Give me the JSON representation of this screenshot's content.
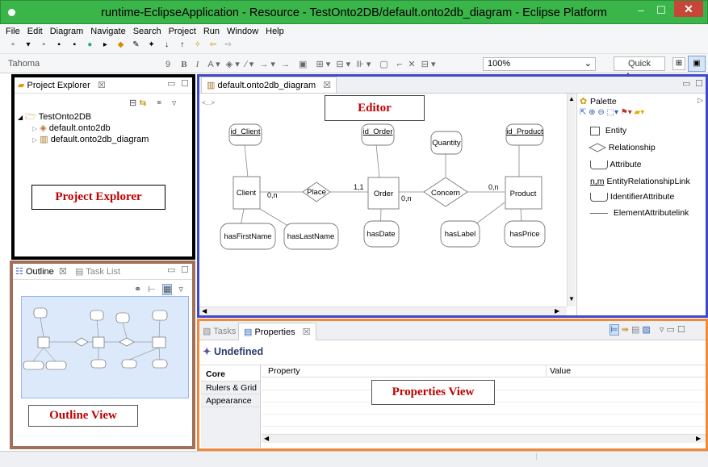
{
  "window": {
    "title": "runtime-EclipseApplication - Resource - TestOnto2DB/default.onto2db_diagram - Eclipse Platform",
    "minimize": "–",
    "maximize": "☐",
    "close": "✕"
  },
  "menu": [
    "File",
    "Edit",
    "Diagram",
    "Navigate",
    "Search",
    "Project",
    "Run",
    "Window",
    "Help"
  ],
  "toolbar2": {
    "font": "Tahoma",
    "font_size": "9",
    "bold": "B",
    "italic": "I",
    "zoom": "100%",
    "quick_access": "Quick Access"
  },
  "project_explorer": {
    "tab_label": "Project Explorer",
    "tab_close": "☒",
    "tree": {
      "project": "TestOnto2DB",
      "files": [
        "default.onto2db",
        "default.onto2db_diagram"
      ]
    },
    "annotation": "Project Explorer"
  },
  "outline": {
    "tab_label": "Outline",
    "tab_close": "☒",
    "tasklist_label": "Task List",
    "annotation": "Outline View"
  },
  "editor": {
    "tab_label": "default.onto2db_diagram",
    "tab_close": "☒",
    "annotation": "Editor",
    "corner_text": "<...>",
    "diagram": {
      "entities": [
        "Client",
        "Order",
        "Product"
      ],
      "relationships": [
        "Place",
        "Concern"
      ],
      "identifier_attributes": [
        "id_Client",
        "id_Order",
        "id_Product"
      ],
      "attributes": [
        "Quantity",
        "hasFirstName",
        "hasLastName",
        "hasDate",
        "hasLabel",
        "hasPrice"
      ],
      "cardinalities": [
        "0,n",
        "1,1",
        "0,n",
        "0,n"
      ]
    }
  },
  "palette": {
    "title": "Palette",
    "items": [
      {
        "label": "Entity",
        "icon": "entity-icon"
      },
      {
        "label": "Relationship",
        "icon": "relationship-icon"
      },
      {
        "label": "Attribute",
        "icon": "attribute-icon"
      },
      {
        "label": "EntityRelationshipLink",
        "icon": "link-nm-icon",
        "prefix": "n,m"
      },
      {
        "label": "IdentifierAttribute",
        "icon": "identifier-attribute-icon"
      },
      {
        "label": "ElementAttributelink",
        "icon": "line-icon"
      }
    ]
  },
  "properties": {
    "tasks_tab": "Tasks",
    "tab_label": "Properties",
    "tab_close": "☒",
    "heading": "Undefined",
    "side_tabs": [
      "Core",
      "Rulers & Grid",
      "Appearance"
    ],
    "col_property": "Property",
    "col_value": "Value",
    "annotation": "Properties View"
  },
  "colors": {
    "titlebar": "#3ab54a",
    "explorer_border": "#000000",
    "outline_border": "#a0705a",
    "editor_border": "#3f48cc",
    "properties_border": "#f08a3a",
    "annotation_text": "#c00000"
  }
}
